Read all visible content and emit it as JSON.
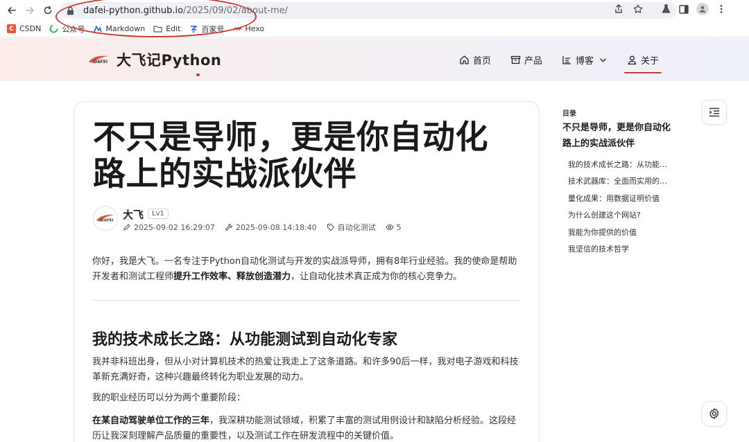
{
  "browser": {
    "url_host": "dafei-python.github.io",
    "url_path": "/2025/09/02/about-me/",
    "bookmarks": [
      {
        "label": "CSDN",
        "icon": "csdn-icon",
        "color": "#e8543a"
      },
      {
        "label": "公众号",
        "icon": "wechat-icon",
        "color": "#3cb371"
      },
      {
        "label": "Markdown",
        "icon": "markdown-icon",
        "color": "#2b62c6"
      },
      {
        "label": "Edit",
        "icon": "folder-icon",
        "color": "#555555"
      },
      {
        "label": "百家号",
        "icon": "baijiahao-icon",
        "color": "#2f6fe0"
      },
      {
        "label": "Hexo",
        "icon": "hexo-icon",
        "color": "#d4312a"
      }
    ]
  },
  "site": {
    "title": "大飞记Python",
    "logo_text": "DAFEI",
    "nav": [
      {
        "label": "首页",
        "icon": "home-icon"
      },
      {
        "label": "产品",
        "icon": "box-icon"
      },
      {
        "label": "博客",
        "icon": "list-icon"
      },
      {
        "label": "关于",
        "icon": "user-icon"
      }
    ],
    "accent": "#c73a3a"
  },
  "article": {
    "title": "不只是导师，更是你自动化路上的实战派伙伴",
    "author": "大飞",
    "level": "Lv1",
    "created": "2025-09-02 16:29:07",
    "updated": "2025-09-08 14:18:40",
    "category": "自动化测试",
    "views": "5",
    "intro_a": "你好，我是大飞。一名专注于Python自动化测试与开发的实战派导师，拥有8年行业经验。我的使命是帮助开发者和测试工程师",
    "intro_b1": "提升工作效率",
    "intro_sep": "、",
    "intro_b2": "释放创造潜力",
    "intro_c": "，让自动化技术真正成为你的核心竞争力。",
    "h2": "我的技术成长之路：从功能测试到自动化专家",
    "p1": "我并非科班出身，但从小对计算机技术的热爱让我走上了这条道路。和许多90后一样，我对电子游戏和科技革新充满好奇，这种兴趣最终转化为职业发展的动力。",
    "p2": "我的职业经历可以分为两个重要阶段：",
    "p3_bold": "在某自动驾驶单位工作的三年",
    "p3_rest": "，我深耕功能测试领域，积累了丰富的测试用例设计和缺陷分析经验。这段经历让我深刻理解产品质量的重要性，以及测试工作在研发流程中的关键价值。"
  },
  "toc": {
    "label": "目录",
    "title": "不只是导师，更是你自动化路上的实战派伙伴",
    "items": [
      "我的技术成长之路：从功能测试到自动化专家",
      "技术武器库：全面而实用的技能栈",
      "量化成果：用数据证明价值",
      "为什么创建这个网站?",
      "我能为你提供的价值",
      "我坚信的技术哲学"
    ]
  }
}
